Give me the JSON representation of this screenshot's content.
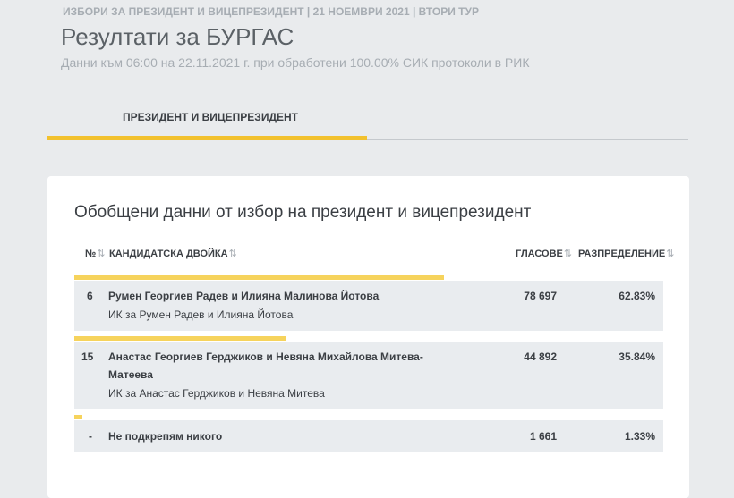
{
  "header": {
    "breadcrumb": "ИЗБОРИ ЗА ПРЕЗИДЕНТ И ВИЦЕПРЕЗИДЕНТ | 21 НОЕМВРИ 2021 | ВТОРИ ТУР",
    "title": "Резултати за БУРГАС",
    "subtitle": "Данни към 06:00 на 22.11.2021 г. при обработени 100.00% СИК протоколи в РИК"
  },
  "tabs": [
    {
      "label": "ПРЕЗИДЕНТ И ВИЦЕПРЕЗИДЕНТ",
      "active": true
    }
  ],
  "accent_color": "#f2c12e",
  "card": {
    "title": "Обобщени данни от избор на президент и вицепрезидент",
    "columns": {
      "num": "№",
      "candidate": "КАНДИДАТСКА ДВОЙКА",
      "votes": "ГЛАСОВЕ",
      "share": "РАЗПРЕДЕЛЕНИЕ"
    },
    "sort_icon": "⇅",
    "rows": [
      {
        "num": "6",
        "name_line1": "Румен Георгиев Радев и Илияна Малинова Йотова",
        "name_line2": "",
        "party": "ИК за Румен Радев и Илияна Йотова",
        "votes": "78 697",
        "share": "62.83%",
        "share_value": 62.83
      },
      {
        "num": "15",
        "name_line1": "Анастас Георгиев Герджиков и Невяна Михайлова Митева-",
        "name_line2": "Матеева",
        "party": "ИК за Анастас Герджиков и Невяна Митева",
        "votes": "44 892",
        "share": "35.84%",
        "share_value": 35.84
      },
      {
        "num": "-",
        "name_line1": "Не подкрепям никого",
        "name_line2": "",
        "party": "",
        "votes": "1 661",
        "share": "1.33%",
        "share_value": 1.33
      }
    ]
  }
}
